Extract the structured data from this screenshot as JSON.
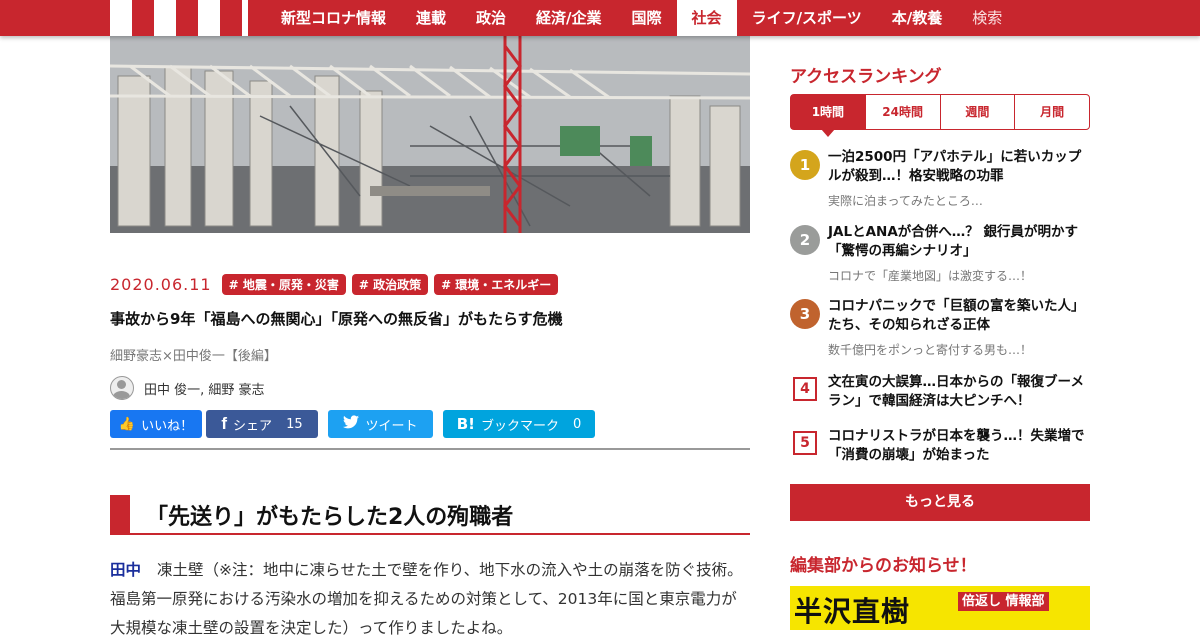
{
  "nav": {
    "items": [
      "新型コロナ情報",
      "連載",
      "政治",
      "経済/企業",
      "国際",
      "社会",
      "ライフ/スポーツ",
      "本/教養"
    ],
    "active_label": "社会",
    "search_label": "検索"
  },
  "article": {
    "date": "2020.06.11",
    "tags": [
      "# 地震・原発・災害",
      "# 政治政策",
      "# 環境・エネルギー"
    ],
    "title": "事故から9年「福島への無関心」「原発への無反省」がもたらす危機",
    "subtitle": "細野豪志×田中俊一【後編】",
    "authors": "田中 俊一, 細野 豪志",
    "share": {
      "like": "いいね！",
      "share_label": "シェア",
      "share_count": "15",
      "tweet": "ツイート",
      "bookmark_label": "ブックマーク",
      "bookmark_count": "0"
    },
    "section_heading": "「先送り」がもたらした2人の殉職者",
    "speaker": "田中",
    "body_text": "凍土壁（※注：地中に凍らせた土で壁を作り、地下水の流入や土の崩落を防ぐ技術。福島第一原発における汚染水の増加を抑えるための対策として、2013年に国と東京電力が大規模な凍土壁の設置を決定した）って作りましたよね。"
  },
  "ranking": {
    "title": "アクセスランキング",
    "tabs": [
      "1時間",
      "24時間",
      "週間",
      "月間"
    ],
    "active_tab": "1時間",
    "items": [
      {
        "rank": "1",
        "title": "一泊2500円「アパホテル」に若いカップルが殺到…！格安戦略の功罪",
        "sub": "実際に泊まってみたところ…"
      },
      {
        "rank": "2",
        "title": "JALとANAが合併へ…？ 銀行員が明かす「驚愕の再編シナリオ」",
        "sub": "コロナで「産業地図」は激変する…！"
      },
      {
        "rank": "3",
        "title": "コロナパニックで「巨額の富を築いた人」たち、その知られざる正体",
        "sub": "数千億円をポンっと寄付する男も…！"
      },
      {
        "rank": "4",
        "title": "文在寅の大誤算…日本からの「報復ブーメラン」で韓国経済は大ピンチへ！",
        "sub": ""
      },
      {
        "rank": "5",
        "title": "コロナリストラが日本を襲う…！失業増で「消費の崩壊」が始まった",
        "sub": ""
      }
    ],
    "more_label": "もっと見る"
  },
  "notice": {
    "title": "編集部からのお知らせ！",
    "banner_text": "半沢直樹",
    "banner_badge": "倍返し 情報部"
  },
  "colors": {
    "brand_red": "#c8262e",
    "gold": "#d4a51c",
    "silver": "#9a9c9a",
    "bronze": "#c0632e",
    "speaker_blue": "#1a2e9c"
  },
  "icons": [
    "thumbs-up-icon",
    "facebook-icon",
    "twitter-icon",
    "hatena-bookmark-icon",
    "avatar-icon"
  ]
}
